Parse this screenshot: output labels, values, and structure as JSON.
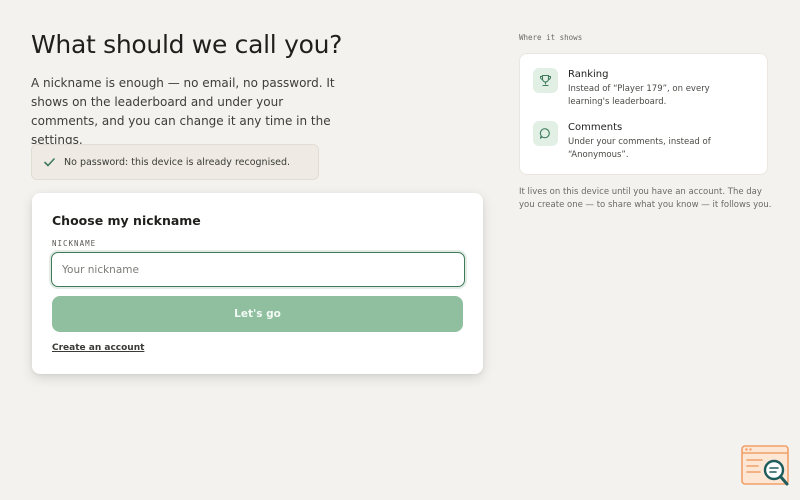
{
  "header": {
    "title": "What should we call you?",
    "intro": "A nickname is enough — no email, no password. It shows on the leaderboard and under your comments, and you can change it any time in the settings."
  },
  "notice": {
    "text": "No password: this device is already recognised.",
    "icon": "check-icon"
  },
  "form": {
    "title": "Choose my nickname",
    "field_label": "NICKNAME",
    "placeholder": "Your nickname",
    "value": "",
    "submit_label": "Let's go",
    "create_account_label": "Create an account"
  },
  "sidebar": {
    "section_label": "Where it shows",
    "items": [
      {
        "title": "Ranking",
        "description": "Instead of “Player 179”, on every learning's leaderboard.",
        "icon": "trophy-icon"
      },
      {
        "title": "Comments",
        "description": "Under your comments, instead of “Anonymous”.",
        "icon": "comment-icon"
      }
    ],
    "footnote": "It lives on this device until you have an account. The day you create one — to share what you know — it follows you."
  },
  "colors": {
    "background": "#f4f2ee",
    "accent": "#3f7a5a",
    "button": "#8fbf9f",
    "widget": "#f0a06a"
  }
}
